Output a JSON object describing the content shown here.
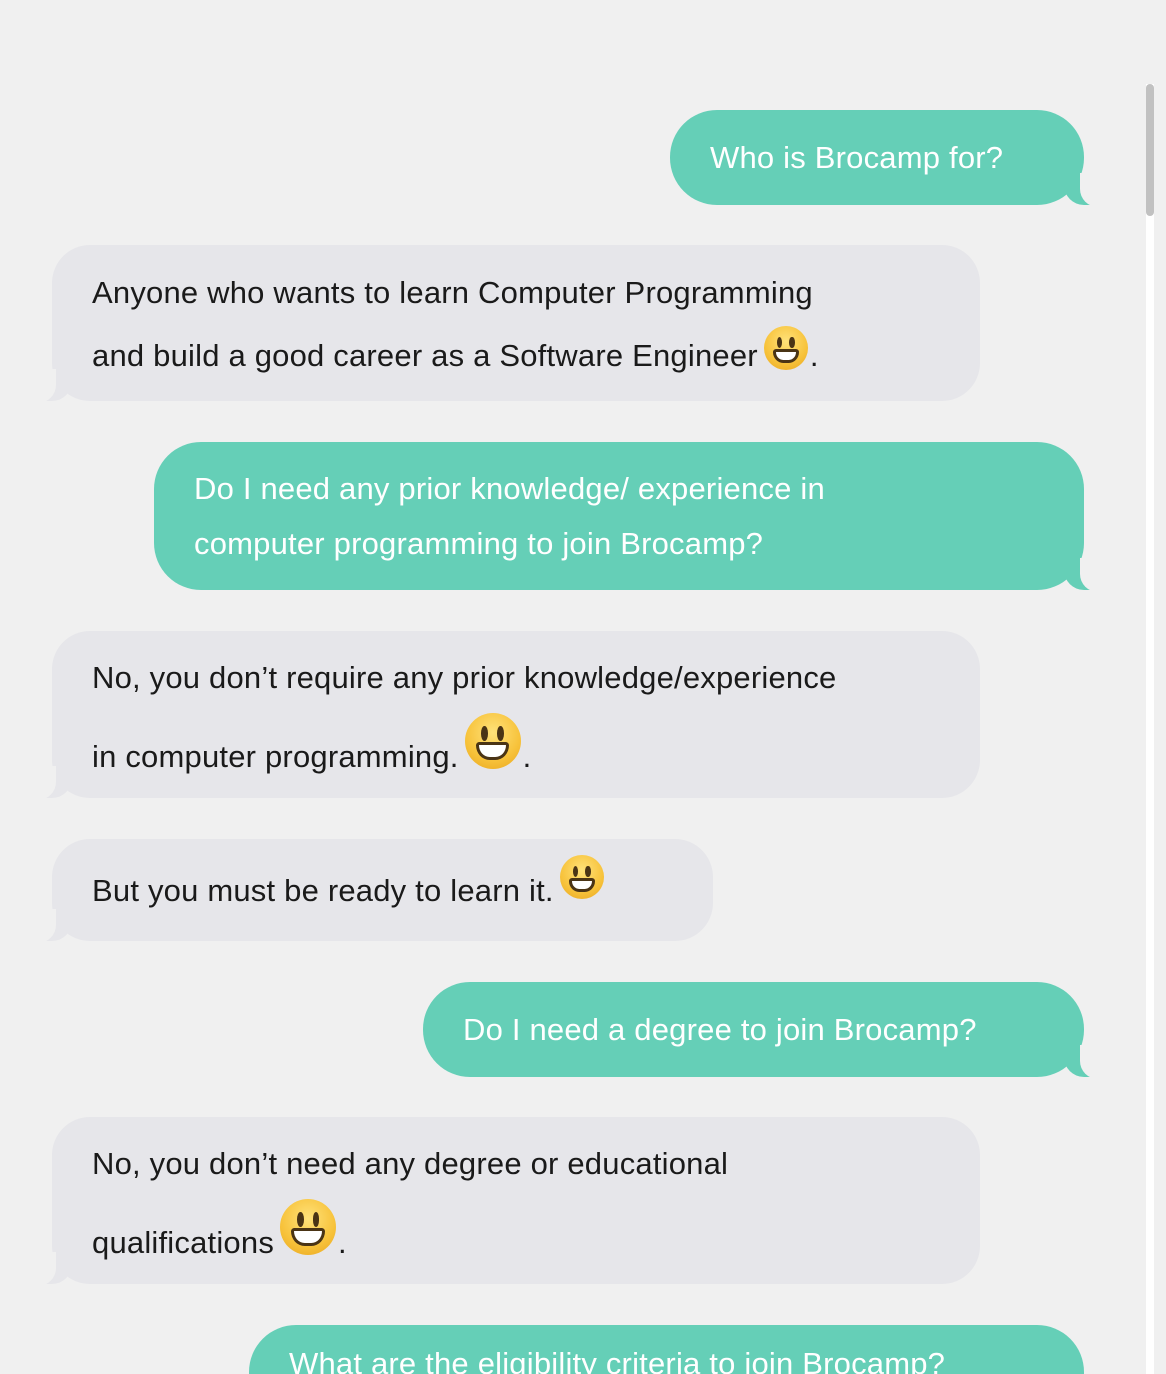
{
  "messages": [
    {
      "from": "user",
      "lines": [
        "Who is Brocamp for?"
      ]
    },
    {
      "from": "bot",
      "lines": [
        "Anyone who wants to learn Computer Programming",
        "and build a good career as a Software Engineer"
      ],
      "emoji": "grinning-face-emoji",
      "suffix": "."
    },
    {
      "from": "user",
      "lines": [
        "Do I need any prior knowledge/ experience in",
        "computer programming to join Brocamp?"
      ]
    },
    {
      "from": "bot",
      "lines": [
        "No, you don’t require any prior knowledge/experience",
        "in computer programming."
      ],
      "emoji": "grinning-face-emoji",
      "suffix": "."
    },
    {
      "from": "bot",
      "lines": [
        "But you must be ready to learn it."
      ],
      "emoji": "grinning-face-emoji"
    },
    {
      "from": "user",
      "lines": [
        "Do I need a degree to join Brocamp?"
      ]
    },
    {
      "from": "bot",
      "lines": [
        "No, you don’t need any degree or educational",
        "qualifications"
      ],
      "emoji": "grinning-face-emoji",
      "suffix": "."
    },
    {
      "from": "user",
      "lines": [
        "What are the eligibility criteria to join Brocamp?"
      ]
    }
  ],
  "colors": {
    "user_bubble": "#65cfb7",
    "bot_bubble": "#e6e6ea",
    "background": "#f0f0f0"
  }
}
